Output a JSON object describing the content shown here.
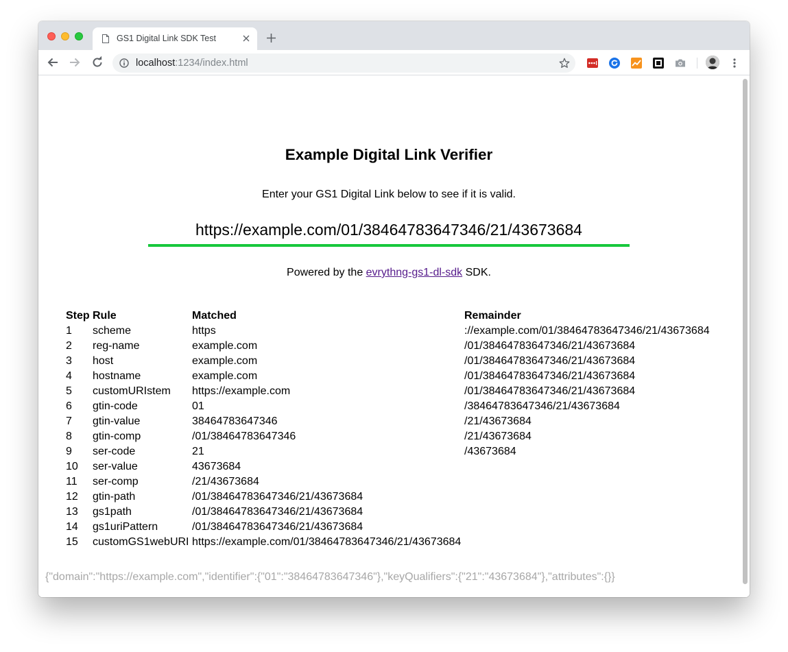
{
  "browser": {
    "tab_title": "GS1 Digital Link SDK Test",
    "url_host": "localhost",
    "url_path": ":1234/index.html"
  },
  "page": {
    "heading": "Example Digital Link Verifier",
    "intro": "Enter your GS1 Digital Link below to see if it is valid.",
    "input_value": "https://example.com/01/38464783647346/21/43673684",
    "powered_prefix": "Powered by the ",
    "powered_link": "evrythng-gs1-dl-sdk",
    "powered_suffix": " SDK.",
    "table": {
      "headers": [
        "Step",
        "Rule",
        "Matched",
        "Remainder"
      ],
      "rows": [
        [
          "1",
          "scheme",
          "https",
          "://example.com/01/38464783647346/21/43673684"
        ],
        [
          "2",
          "reg-name",
          "example.com",
          "/01/38464783647346/21/43673684"
        ],
        [
          "3",
          "host",
          "example.com",
          "/01/38464783647346/21/43673684"
        ],
        [
          "4",
          "hostname",
          "example.com",
          "/01/38464783647346/21/43673684"
        ],
        [
          "5",
          "customURIstem",
          "https://example.com",
          "/01/38464783647346/21/43673684"
        ],
        [
          "6",
          "gtin-code",
          "01",
          "/38464783647346/21/43673684"
        ],
        [
          "7",
          "gtin-value",
          "38464783647346",
          "/21/43673684"
        ],
        [
          "8",
          "gtin-comp",
          "/01/38464783647346",
          "/21/43673684"
        ],
        [
          "9",
          "ser-code",
          "21",
          "/43673684"
        ],
        [
          "10",
          "ser-value",
          "43673684",
          ""
        ],
        [
          "11",
          "ser-comp",
          "/21/43673684",
          ""
        ],
        [
          "12",
          "gtin-path",
          "/01/38464783647346/21/43673684",
          ""
        ],
        [
          "13",
          "gs1path",
          "/01/38464783647346/21/43673684",
          ""
        ],
        [
          "14",
          "gs1uriPattern",
          "/01/38464783647346/21/43673684",
          ""
        ],
        [
          "15",
          "customGS1webURI",
          "https://example.com/01/38464783647346/21/43673684",
          ""
        ]
      ]
    },
    "json_output": "{\"domain\":\"https://example.com\",\"identifier\":{\"01\":\"38464783647346\"},\"keyQualifiers\":{\"21\":\"43673684\"},\"attributes\":{}}"
  },
  "icons": [
    "document-icon",
    "close-icon",
    "plus-icon",
    "back-arrow-icon",
    "forward-arrow-icon",
    "reload-icon",
    "info-icon",
    "star-icon",
    "lastpass-icon",
    "sync-icon",
    "analytics-icon",
    "square-icon",
    "camera-icon",
    "avatar",
    "menu-icon"
  ],
  "colors": {
    "accent_underline": "#17c83c",
    "link": "#551a8b",
    "json_text": "#a7a7a7"
  }
}
